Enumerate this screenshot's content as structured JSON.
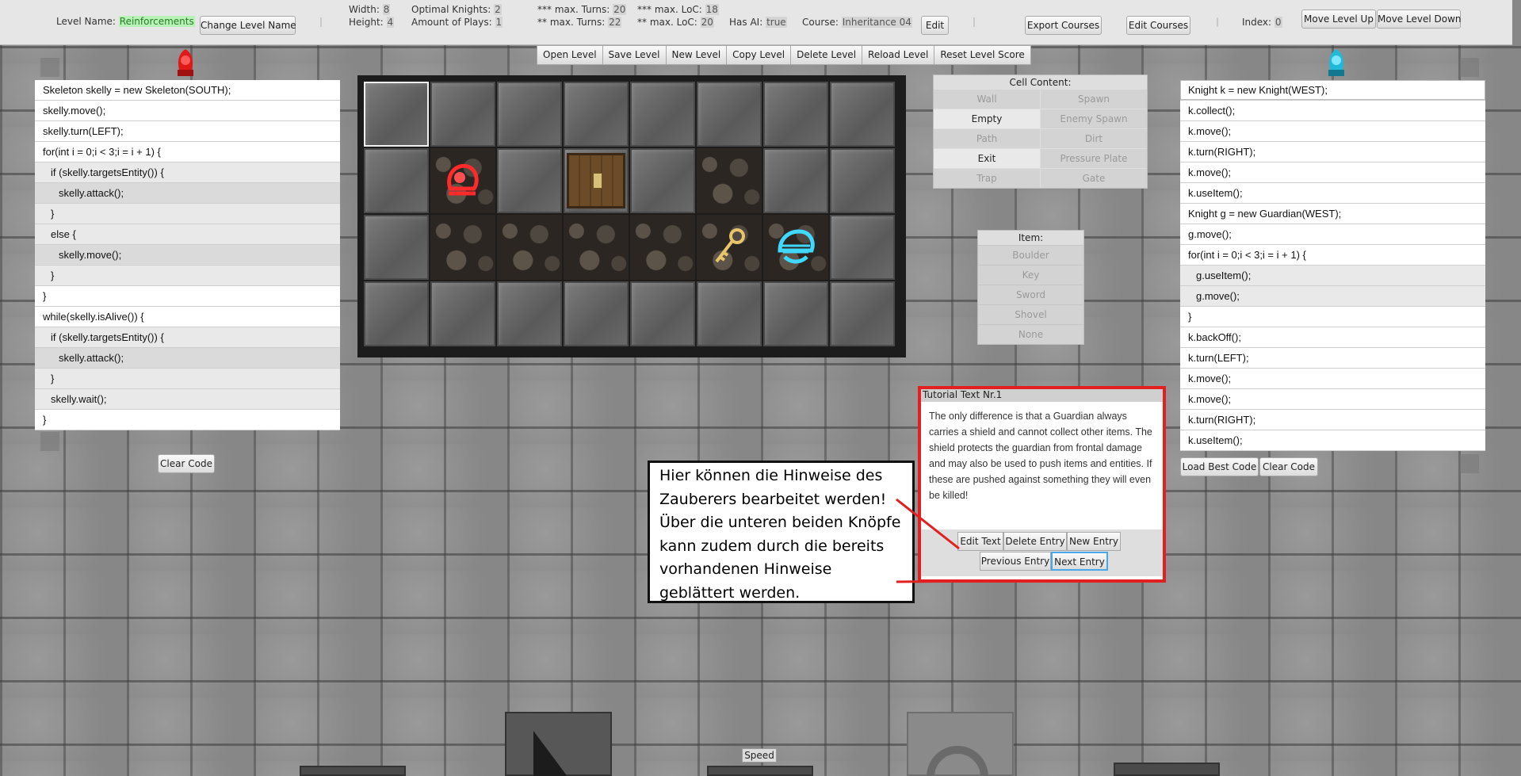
{
  "top": {
    "level_name_label": "Level Name:",
    "level_name": "Reinforcements",
    "change_level_name": "Change Level Name",
    "width_label": "Width:",
    "width": "8",
    "height_label": "Height:",
    "height": "4",
    "optimal_knights_label": "Optimal Knights:",
    "optimal_knights": "2",
    "amount_of_plays_label": "Amount of Plays:",
    "amount_of_plays": "1",
    "max_turns3_label": "*** max. Turns:",
    "max_turns3": "20",
    "max_turns2_label": "** max. Turns:",
    "max_turns2": "22",
    "max_loc3_label": "*** max. LoC:",
    "max_loc3": "18",
    "max_loc2_label": "** max. LoC:",
    "max_loc2": "20",
    "has_ai_label": "Has AI:",
    "has_ai": "true",
    "course_label": "Course:",
    "course": "Inheritance 04",
    "edit": "Edit",
    "export_courses": "Export Courses",
    "edit_courses": "Edit Courses",
    "index_label": "Index:",
    "index": "0",
    "move_level_up": "Move Level Up",
    "move_level_down": "Move Level Down"
  },
  "level_buttons": [
    "Open Level",
    "Save Level",
    "New Level",
    "Copy Level",
    "Delete Level",
    "Reload Level",
    "Reset Level Score"
  ],
  "left_code": [
    {
      "text": "Skeleton skelly = new Skeleton(SOUTH);",
      "indent": 0
    },
    {
      "text": "skelly.move();",
      "indent": 0
    },
    {
      "text": "skelly.turn(LEFT);",
      "indent": 0
    },
    {
      "text": "for(int i = 0;i < 3;i = i + 1) {",
      "indent": 0
    },
    {
      "text": "if (skelly.targetsEntity()) {",
      "indent": 1
    },
    {
      "text": "skelly.attack();",
      "indent": 2
    },
    {
      "text": "}",
      "indent": 1
    },
    {
      "text": "else {",
      "indent": 1
    },
    {
      "text": "skelly.move();",
      "indent": 2
    },
    {
      "text": "}",
      "indent": 1
    },
    {
      "text": "}",
      "indent": 0
    },
    {
      "text": "while(skelly.isAlive()) {",
      "indent": 0
    },
    {
      "text": "if (skelly.targetsEntity()) {",
      "indent": 1
    },
    {
      "text": "skelly.attack();",
      "indent": 2
    },
    {
      "text": "}",
      "indent": 1
    },
    {
      "text": "skelly.wait();",
      "indent": 1
    },
    {
      "text": "}",
      "indent": 0
    }
  ],
  "clear_code_left": "Clear Code",
  "right_code": [
    {
      "text": "Knight k = new Knight(WEST);",
      "indent": 0
    },
    {
      "text": "k.collect();",
      "indent": 0
    },
    {
      "text": "k.move();",
      "indent": 0
    },
    {
      "text": "k.turn(RIGHT);",
      "indent": 0
    },
    {
      "text": "k.move();",
      "indent": 0
    },
    {
      "text": "k.useItem();",
      "indent": 0
    },
    {
      "text": "Knight g = new Guardian(WEST);",
      "indent": 0
    },
    {
      "text": "g.move();",
      "indent": 0
    },
    {
      "text": "for(int i = 0;i < 3;i = i + 1) {",
      "indent": 0
    },
    {
      "text": "g.useItem();",
      "indent": 1
    },
    {
      "text": "g.move();",
      "indent": 1
    },
    {
      "text": "}",
      "indent": 0
    },
    {
      "text": "k.backOff();",
      "indent": 0
    },
    {
      "text": "k.turn(LEFT);",
      "indent": 0
    },
    {
      "text": "k.move();",
      "indent": 0
    },
    {
      "text": "k.move();",
      "indent": 0
    },
    {
      "text": "k.turn(RIGHT);",
      "indent": 0
    },
    {
      "text": "k.useItem();",
      "indent": 0
    }
  ],
  "load_best_code": "Load Best Code",
  "clear_code_right": "Clear Code",
  "board": {
    "rows": [
      [
        "wall",
        "wall",
        "wall",
        "wall",
        "wall",
        "wall",
        "wall",
        "wall"
      ],
      [
        "wall",
        "skeleton",
        "wall",
        "chest",
        "wall",
        "path",
        "wall",
        "wall"
      ],
      [
        "wall",
        "path",
        "path",
        "path",
        "path",
        "key",
        "guardian",
        "wall"
      ],
      [
        "wall",
        "wall",
        "wall",
        "wall",
        "wall",
        "wall",
        "wall",
        "wall"
      ]
    ],
    "icons": {
      "skeleton": "skeleton-icon",
      "chest": "exit-door-icon",
      "key": "key-icon",
      "guardian": "knight-guardian-icon"
    },
    "colors": {
      "skeleton": "#ff2a2a",
      "key": "#e8c56a",
      "guardian": "#3fd8ff"
    }
  },
  "cell_content": {
    "title": "Cell Content:",
    "options": [
      {
        "label": "Wall",
        "enabled": false
      },
      {
        "label": "Spawn",
        "enabled": false
      },
      {
        "label": "Empty",
        "enabled": true
      },
      {
        "label": "Enemy Spawn",
        "enabled": false
      },
      {
        "label": "Path",
        "enabled": false
      },
      {
        "label": "Dirt",
        "enabled": false
      },
      {
        "label": "Exit",
        "enabled": true
      },
      {
        "label": "Pressure Plate",
        "enabled": false
      },
      {
        "label": "Trap",
        "enabled": false
      },
      {
        "label": "Gate",
        "enabled": false
      }
    ]
  },
  "item_panel": {
    "title": "Item:",
    "options": [
      "Boulder",
      "Key",
      "Sword",
      "Shovel",
      "None"
    ]
  },
  "tutorial": {
    "title": "Tutorial Text Nr.1",
    "text": "The only difference is that a Guardian always carries a shield and cannot collect other items. The shield protects the guardian from frontal damage and may also be used to push items and entities. If these are pushed against something they will even be killed!",
    "edit_text": "Edit Text",
    "delete_entry": "Delete Entry",
    "new_entry": "New Entry",
    "previous_entry": "Previous Entry",
    "next_entry": "Next Entry"
  },
  "callout": {
    "text": "Hier können die Hinweise des Zauberers bearbeitet werden! Über die unteren beiden Knöpfe kann zudem durch die bereits vorhandenen Hinweise geblättert werden.",
    "line_color": "#e32020"
  },
  "speed_label": "Speed",
  "accent": {
    "red": "#e32020",
    "player_red": "#ff2a2a",
    "player_blue": "#3fd8ff",
    "green": "#b7f2b7"
  }
}
